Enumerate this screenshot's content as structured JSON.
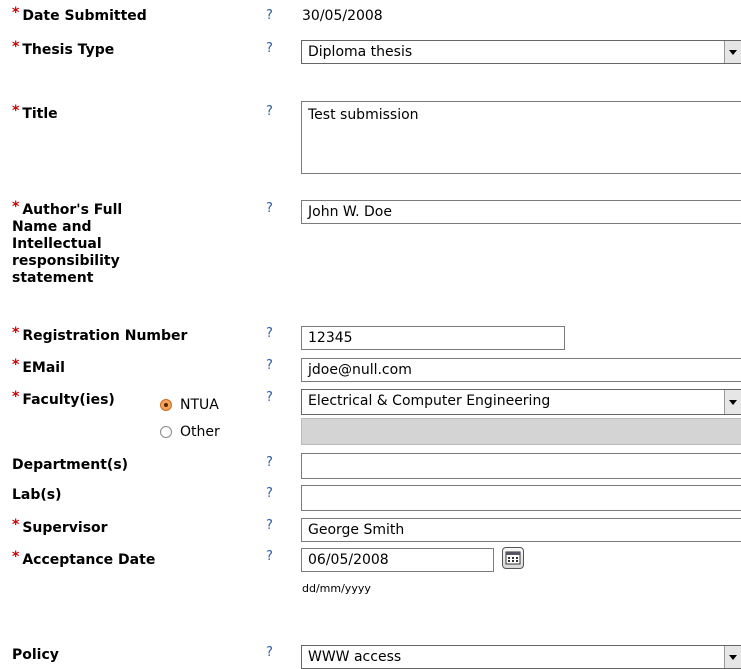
{
  "help": "?",
  "required_mark": "*",
  "fields": {
    "date_submitted": {
      "label": "Date Submitted",
      "value": "30/05/2008"
    },
    "thesis_type": {
      "label": "Thesis Type",
      "value": "Diploma thesis"
    },
    "title": {
      "label": "Title",
      "value": "Test submission"
    },
    "author": {
      "label_lines": [
        "Author's Full",
        "Name and",
        "Intellectual",
        "responsibility",
        "statement"
      ],
      "value": "John W. Doe"
    },
    "registration": {
      "label": "Registration Number",
      "value": "12345"
    },
    "email": {
      "label": "EMail",
      "value": "jdoe@null.com"
    },
    "faculty": {
      "label": "Faculty(ies)",
      "radio_ntua": "NTUA",
      "radio_other": "Other",
      "selected_radio": "NTUA",
      "value": "Electrical & Computer Engineering"
    },
    "department": {
      "label": "Department(s)",
      "value": ""
    },
    "lab": {
      "label": "Lab(s)",
      "value": ""
    },
    "supervisor": {
      "label": "Supervisor",
      "value": "George Smith"
    },
    "acceptance_date": {
      "label": "Acceptance Date",
      "value": "06/05/2008",
      "format_hint": "dd/mm/yyyy"
    },
    "policy": {
      "label": "Policy",
      "value": "WWW access"
    }
  }
}
